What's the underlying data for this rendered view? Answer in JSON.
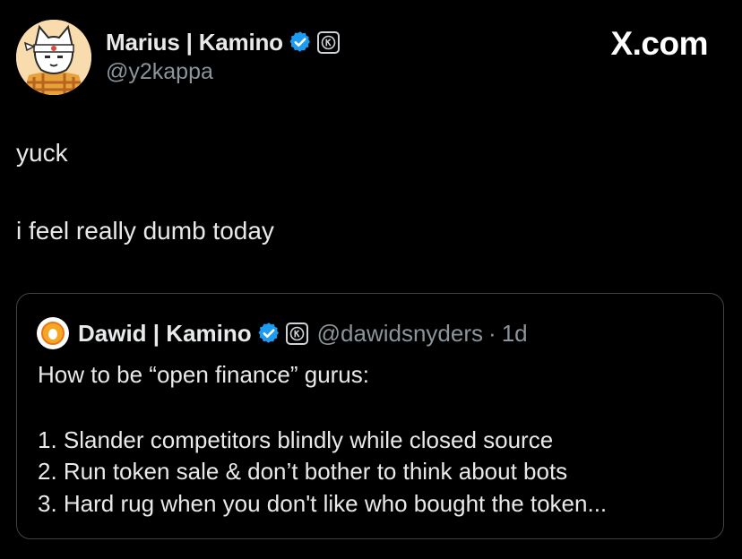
{
  "brand": "X.com",
  "author": {
    "name": "Marius | Kamino",
    "handle": "@y2kappa",
    "avatar": "cartoon-fox-avatar"
  },
  "tweet": {
    "lines": [
      "yuck",
      "i feel really dumb today"
    ]
  },
  "quote": {
    "author_name": "Dawid | Kamino",
    "handle": "@dawidsnyders",
    "separator": "·",
    "time": "1d",
    "lines": [
      "How to be “open finance” gurus:",
      "1. Slander competitors blindly while closed source",
      "2. Run token sale & don’t bother to think about bots",
      "3. Hard rug when you don't like who bought the token..."
    ]
  },
  "colors": {
    "background": "#000000",
    "text": "#e7e9ea",
    "muted": "#8b949a",
    "verified": "#1d9bf0",
    "border": "#3e4348"
  }
}
